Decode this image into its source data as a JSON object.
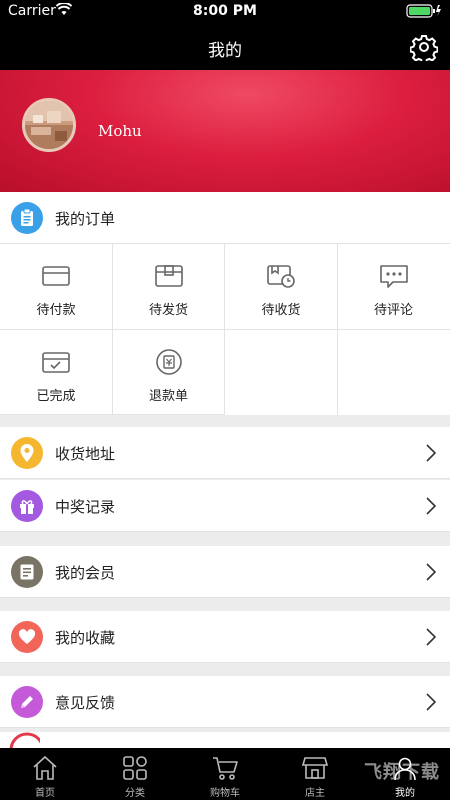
{
  "status_bar": {
    "carrier": "Carrier",
    "time": "8:00 PM"
  },
  "nav": {
    "title": "我的",
    "settings_icon": "gear-icon"
  },
  "profile": {
    "username": "Mohu",
    "avatar": "avatar-photo"
  },
  "orders": {
    "title": "我的订单",
    "icon_color": "#3aa0e8",
    "items": [
      {
        "label": "待付款",
        "icon": "card-icon"
      },
      {
        "label": "待发货",
        "icon": "box-icon"
      },
      {
        "label": "待收货",
        "icon": "delivery-clock-icon"
      },
      {
        "label": "待评论",
        "icon": "comment-icon"
      },
      {
        "label": "已完成",
        "icon": "box-check-icon"
      },
      {
        "label": "退款单",
        "icon": "refund-icon"
      }
    ]
  },
  "menu": [
    {
      "label": "收货地址",
      "icon": "location-icon",
      "color": "#f5b730"
    },
    {
      "label": "中奖记录",
      "icon": "gift-icon",
      "color": "#a35ae0"
    },
    {
      "label": "我的会员",
      "icon": "member-card-icon",
      "color": "#7a7466"
    },
    {
      "label": "我的收藏",
      "icon": "heart-icon",
      "color": "#f2665a"
    },
    {
      "label": "意见反馈",
      "icon": "pencil-icon",
      "color": "#c45ad8"
    }
  ],
  "tabs": [
    {
      "label": "首页",
      "icon": "home-icon"
    },
    {
      "label": "分类",
      "icon": "category-icon"
    },
    {
      "label": "购物车",
      "icon": "cart-icon"
    },
    {
      "label": "店主",
      "icon": "shop-icon"
    },
    {
      "label": "我的",
      "icon": "profile-icon",
      "active": true
    }
  ],
  "watermark": "飞翔下载",
  "colors": {
    "banner": "#dc1e3f",
    "bar": "#000000",
    "accent_blue": "#3aa0e8"
  }
}
